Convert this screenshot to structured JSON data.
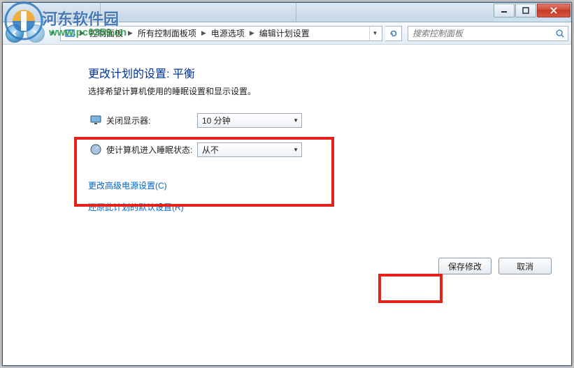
{
  "watermark": {
    "text": "河东软件园",
    "url": "www.pc0359.cn"
  },
  "window": {
    "title_tab1": "…",
    "title_tab2": "…"
  },
  "breadcrumb": {
    "items": [
      "控制面板",
      "所有控制面板项",
      "电源选项",
      "编辑计划设置"
    ]
  },
  "search": {
    "placeholder": "搜索控制面板"
  },
  "page": {
    "heading": "更改计划的设置: 平衡",
    "subtext": "选择希望计算机使用的睡眠设置和显示设置。"
  },
  "settings": {
    "rows": [
      {
        "label": "关闭显示器:",
        "value": "10 分钟"
      },
      {
        "label": "使计算机进入睡眠状态:",
        "value": "从不"
      }
    ]
  },
  "links": {
    "advanced": "更改高级电源设置(C)",
    "restore": "还原此计划的默认设置(R)"
  },
  "buttons": {
    "save": "保存修改",
    "cancel": "取消"
  }
}
